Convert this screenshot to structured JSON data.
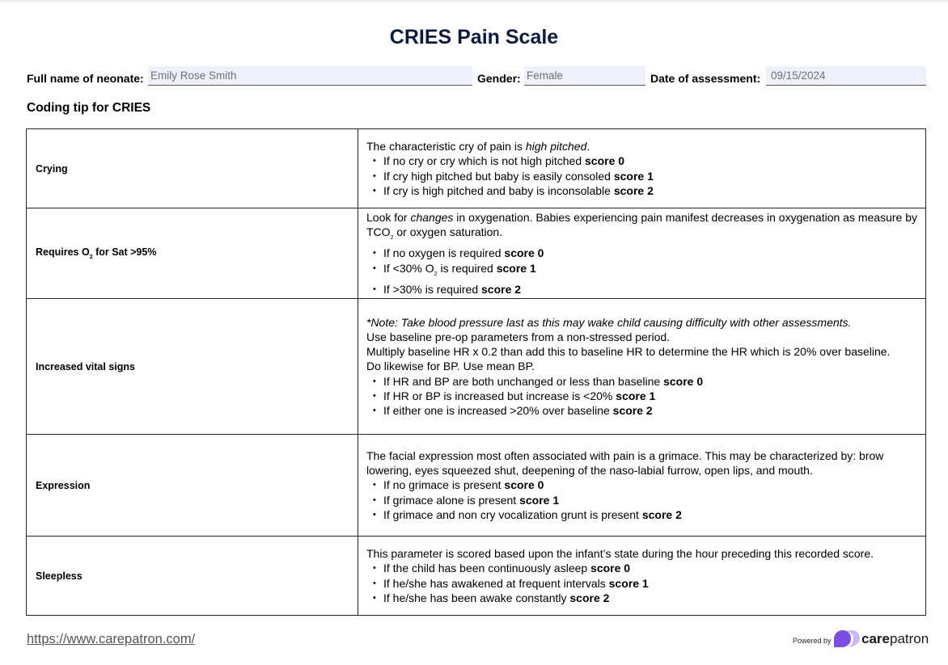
{
  "title": "CRIES Pain Scale",
  "fields": {
    "name_label": "Full name of neonate:",
    "name_value": "Emily Rose Smith",
    "gender_label": "Gender:",
    "gender_value": "Female",
    "date_label": "Date of assessment:",
    "date_value": "09/15/2024"
  },
  "section_title": "Coding tip for CRIES",
  "criteria": [
    {
      "name": "Crying",
      "intro": [
        "The characteristic cry of pain is ",
        "high pitched",
        "."
      ],
      "bullets": [
        {
          "text": "If no cry or cry which is not high pitched ",
          "score": "score 0"
        },
        {
          "text": "If cry high pitched but baby is easily consoled ",
          "score": "score 1"
        },
        {
          "text": "If cry is high pitched and baby is inconsolable ",
          "score": "score 2"
        }
      ]
    },
    {
      "name_pre": "Requires O",
      "name_sub": "2",
      "name_post": " for Sat >95%",
      "intro_a": "Look for ",
      "intro_em": "changes",
      "intro_b": " in oxygenation. Babies experiencing pain manifest decreases in oxygenation as measure by TCO",
      "intro_sub": "2",
      "intro_c": " or oxygen saturation.",
      "bullets": [
        {
          "text": "If no oxygen is required ",
          "score": "score 0"
        },
        {
          "text_pre": "If <30% O",
          "text_sub": "2",
          "text_post": " is required ",
          "score": "score 1"
        },
        {
          "text": "If >30% is required ",
          "score": "score 2"
        }
      ]
    },
    {
      "name": "Increased vital signs",
      "note": "*Note: Take blood pressure last as this may wake child causing difficulty with other assessments.",
      "lines": [
        "Use baseline pre-op parameters from a non-stressed period.",
        "Multiply baseline HR x 0.2 than add this to baseline HR to determine the HR which is 20% over baseline.",
        "Do likewise for BP. Use mean BP."
      ],
      "bullets": [
        {
          "text": "If HR and BP are both unchanged or less than baseline ",
          "score": "score 0"
        },
        {
          "text": "If HR or BP is increased but increase is <20% ",
          "score": "score 1"
        },
        {
          "text": "If either one is increased >20% over baseline ",
          "score": "score 2"
        }
      ]
    },
    {
      "name": "Expression",
      "intro": "The facial expression most often associated with pain is a grimace. This may be characterized by: brow lowering, eyes squeezed shut, deepening of the naso-labial furrow, open lips, and mouth.",
      "bullets": [
        {
          "text": "If no grimace is present ",
          "score": "score 0"
        },
        {
          "text": "If grimace alone is present ",
          "score": "score 1"
        },
        {
          "text": "If grimace and non cry vocalization grunt is present ",
          "score": "score 2"
        }
      ]
    },
    {
      "name": "Sleepless",
      "intro": "This parameter is scored based upon the infant’s state during the hour preceding this recorded score.",
      "bullets": [
        {
          "text": "If the child has been continuously asleep ",
          "score": "score 0"
        },
        {
          "text": "If he/she has awakened at frequent intervals ",
          "score": "score 1"
        },
        {
          "text": "If he/she has been awake constantly ",
          "score": "score 2"
        }
      ]
    }
  ],
  "bullet_glyph": "•",
  "footer": {
    "link": "https://www.carepatron.com/",
    "powered_by": "Powered by",
    "brand_bold": "care",
    "brand_regular": "patron"
  },
  "colors": {
    "title": "#0f1b3d",
    "input_bg": "#eef0fc",
    "logo_primary": "#7b4fe0",
    "logo_secondary": "#c9b8f5"
  }
}
